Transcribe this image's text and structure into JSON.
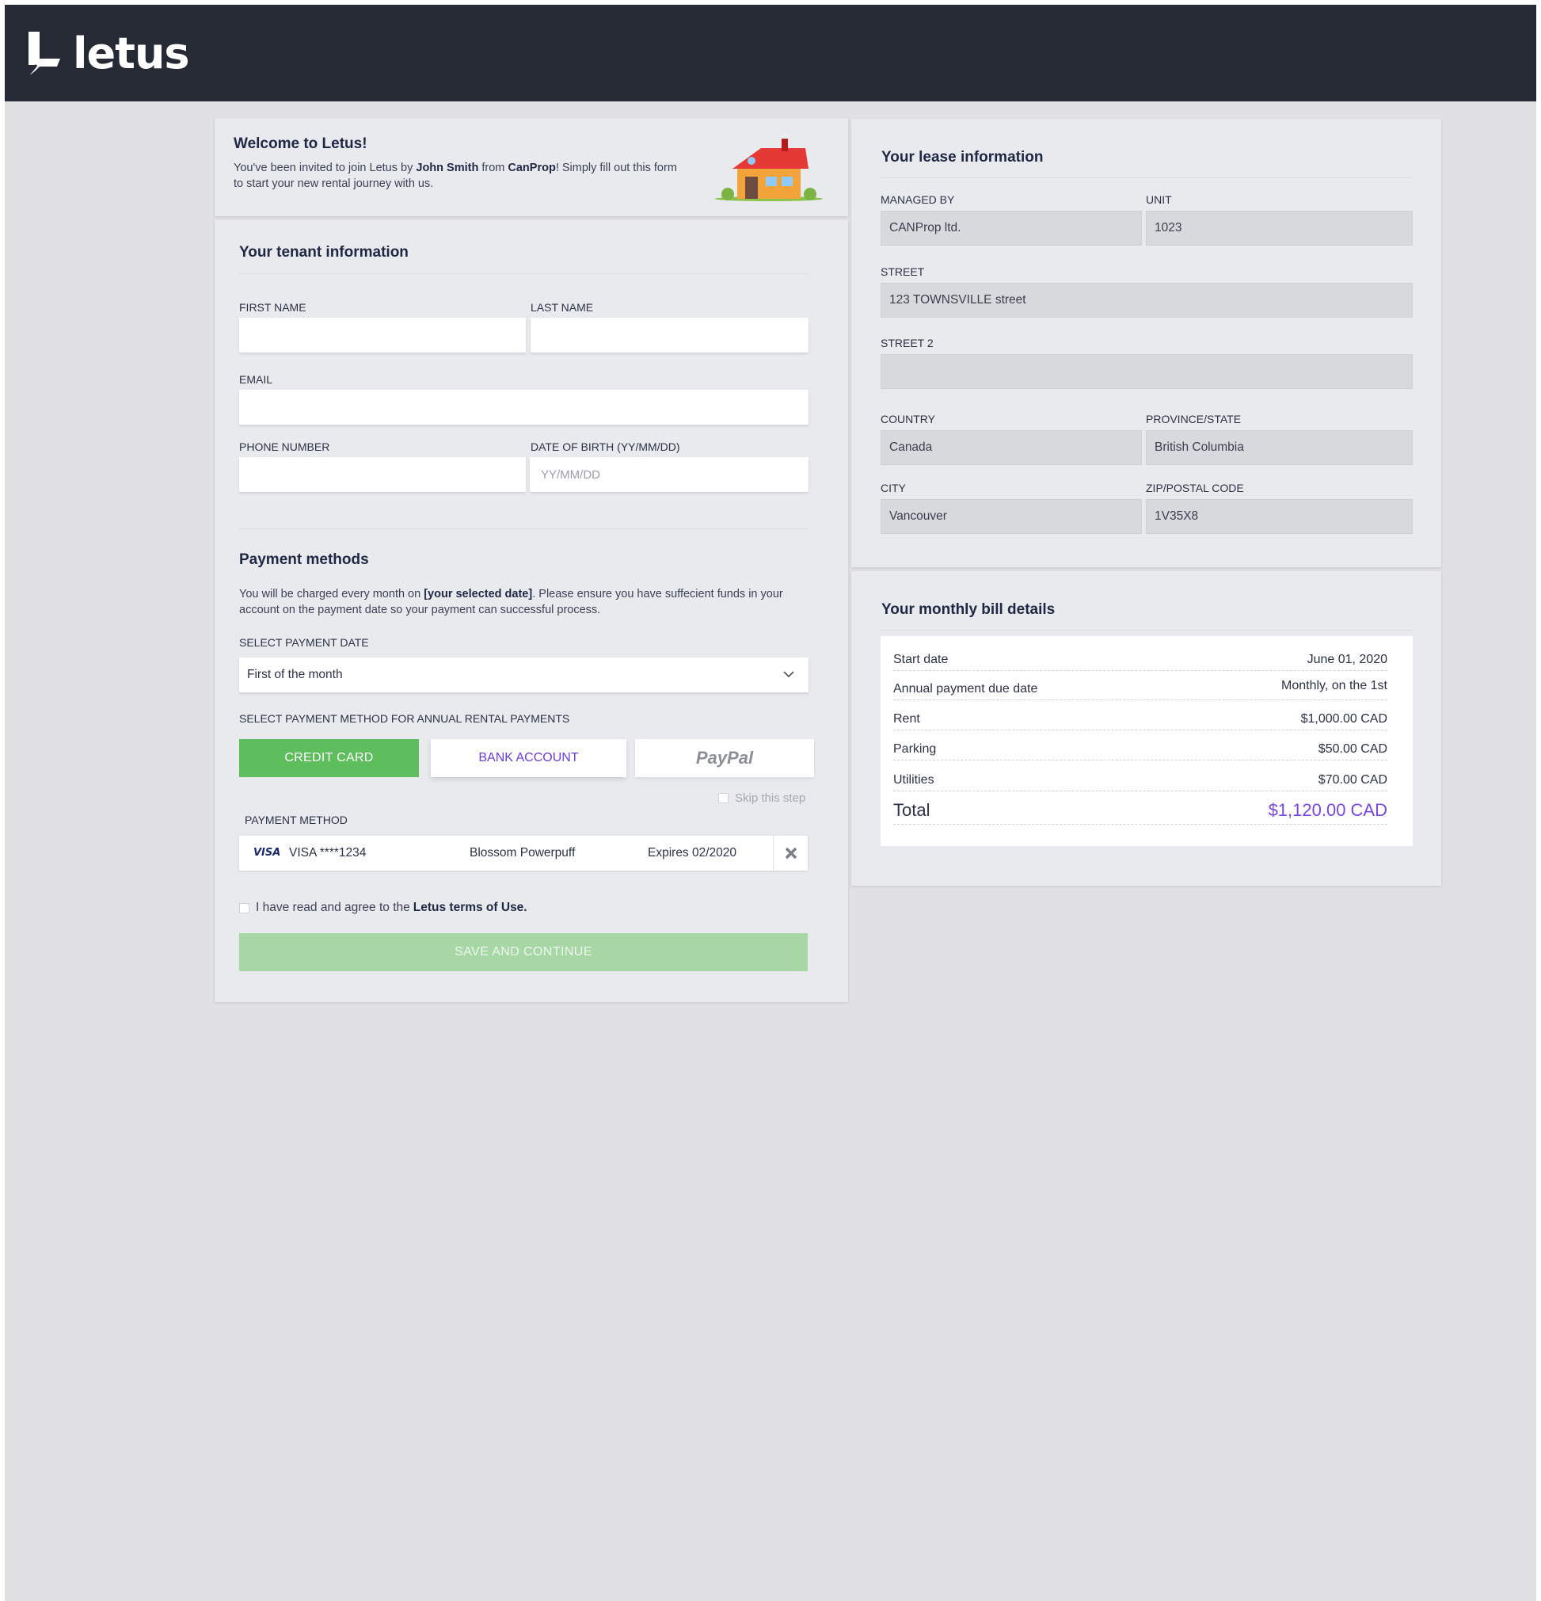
{
  "brand": {
    "name": "letus"
  },
  "welcome": {
    "title": "Welcome to Letus!",
    "text_prefix": "You've been invited to join Letus by ",
    "inviter": "John Smith",
    "text_mid": " from ",
    "company": "CanProp",
    "text_suffix": "! Simply fill out this form to start your new rental journey with us."
  },
  "tenant": {
    "title": "Your tenant information",
    "first_name_label": "FIRST NAME",
    "last_name_label": "LAST NAME",
    "email_label": "EMAIL",
    "phone_label": "PHONE NUMBER",
    "dob_label": "DATE OF BIRTH (YY/MM/DD)",
    "dob_placeholder": "YY/MM/DD"
  },
  "payment": {
    "title": "Payment methods",
    "text_prefix": "You will be charged every month on ",
    "text_bold": "[your selected date]",
    "text_suffix": ". Please ensure you have suffecient funds in your account on the payment date so your payment can successful process.",
    "date_label": "SELECT PAYMENT DATE",
    "date_value": "First of the month",
    "method_select_label": "SELECT PAYMENT METHOD FOR ANNUAL RENTAL PAYMENTS",
    "btn_credit": "CREDIT CARD",
    "btn_bank": "BANK ACCOUNT",
    "btn_paypal": "PayPal",
    "skip": "Skip this step",
    "method_label": "PAYMENT METHOD",
    "card_brand": "VISA",
    "card_number": "VISA ****1234",
    "card_holder": "Blossom Powerpuff",
    "card_expiry": "Expires 02/2020",
    "agree_prefix": "I have read and agree to the",
    "agree_link": "Letus terms of Use.",
    "save": "SAVE AND CONTINUE"
  },
  "lease": {
    "title": "Your lease information",
    "managed_by_label": "MANAGED BY",
    "managed_by": "CANProp ltd.",
    "unit_label": "UNIT",
    "unit": "1023",
    "street_label": "STREET",
    "street": "123 TOWNSVILLE street",
    "street2_label": "STREET 2",
    "street2": "",
    "country_label": "COUNTRY",
    "country": "Canada",
    "province_label": "PROVINCE/STATE",
    "province": "British Columbia",
    "city_label": "CITY",
    "city": "Vancouver",
    "zip_label": "ZIP/POSTAL CODE",
    "zip": "1V35X8"
  },
  "bill": {
    "title": "Your monthly bill details",
    "rows": [
      {
        "label": "Start date",
        "value": "June 01, 2020"
      },
      {
        "label": "Annual payment due date",
        "value": "Monthly, on the 1st"
      },
      {
        "label": "Rent",
        "value": "$1,000.00 CAD"
      },
      {
        "label": "Parking",
        "value": "$50.00 CAD"
      },
      {
        "label": "Utilities",
        "value": "$70.00 CAD"
      }
    ],
    "total_label": "Total",
    "total_value": "$1,120.00 CAD"
  },
  "colors": {
    "topbar": "#252a35",
    "accent_green": "#5ebd5d",
    "accent_purple": "#7a45e0"
  }
}
